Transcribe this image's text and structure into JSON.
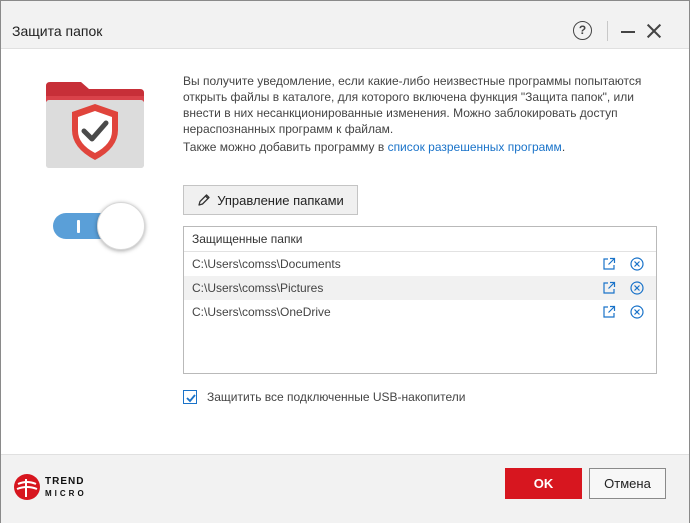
{
  "window": {
    "title": "Защита папок"
  },
  "description": {
    "main": "Вы получите уведомление, если какие-либо неизвестные программы попытаются открыть файлы в каталоге, для которого включена функция \"Защита папок\", или внести в них несанкционированные изменения. Можно заблокировать доступ нераспознанных программ к файлам.",
    "secondary_prefix": "Также можно добавить программу в ",
    "secondary_link": "список разрешенных программ",
    "secondary_suffix": "."
  },
  "toggle": {
    "state": "on"
  },
  "manage_button": {
    "label": "Управление папками",
    "icon": "pencil-icon"
  },
  "folder_list": {
    "header": "Защищенные папки",
    "items": [
      {
        "path": "C:\\Users\\comss\\Documents"
      },
      {
        "path": "C:\\Users\\comss\\Pictures"
      },
      {
        "path": "C:\\Users\\comss\\OneDrive"
      }
    ]
  },
  "usb_option": {
    "label": "Защитить все подключенные USB-накопители",
    "checked": true
  },
  "brand": {
    "line1": "TREND",
    "line2": "MICRO"
  },
  "buttons": {
    "ok": "OK",
    "cancel": "Отмена"
  },
  "colors": {
    "accent_red": "#d7161f",
    "link_blue": "#1a73c9",
    "toggle_blue": "#5a9fd8",
    "folder_red": "#d9424a"
  }
}
